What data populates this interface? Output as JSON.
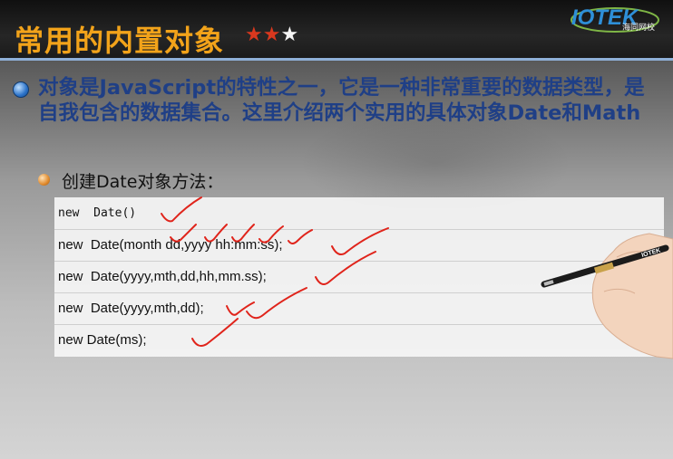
{
  "header": {
    "title": "常用的内置对象",
    "stars": {
      "filled": "★★",
      "empty": "★"
    },
    "logo": {
      "text": "IOTEK",
      "subtext": "海同网校"
    }
  },
  "content": {
    "paragraph": "对象是JavaScript的特性之一，它是一种非常重要的数据类型，是自我包含的数据集合。这里介绍两个实用的具体对象Date和Math",
    "sub_item": "创建Date对象方法：",
    "code_lines": [
      "new  Date()",
      "new  Date(month dd,yyyy hh:mm:ss);",
      "new  Date(yyyy,mth,dd,hh,mm.ss);",
      "new  Date(yyyy,mth,dd);",
      "new Date(ms);"
    ]
  },
  "colors": {
    "title": "#f2a31a",
    "paragraph": "#1f3f86",
    "check_marks": "#e0241b",
    "logo_blue": "#2e8fd8"
  }
}
